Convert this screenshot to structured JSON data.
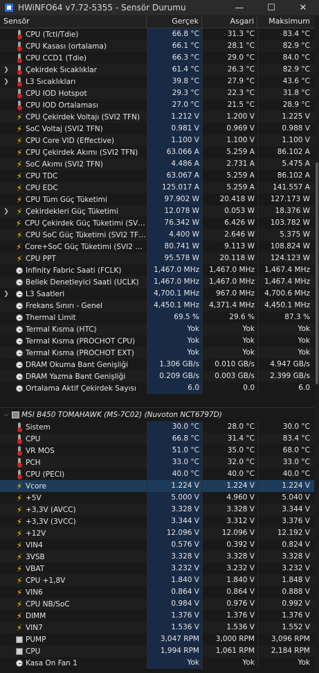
{
  "window": {
    "title": "HWiNFO64 v7.72-5355 - Sensör Durumu",
    "minimize": "—",
    "maximize": "☐",
    "close": "✕"
  },
  "columns": {
    "sensor": "Sensör",
    "current": "Gerçek",
    "min": "Asgari",
    "max": "Maksimum"
  },
  "colors": {
    "background": "#191919",
    "current_column": "#192a45",
    "selected_row": "#1d3c5a",
    "temp_icon": "#d32020",
    "voltage_icon": "#ffcc00"
  },
  "group_cpu": {
    "rows": [
      {
        "icon": "thermometer",
        "exp": false,
        "label": "CPU (Tctl/Tdie)",
        "cur": "66.8 °C",
        "min": "31.3 °C",
        "max": "83.4 °C"
      },
      {
        "icon": "thermometer",
        "exp": false,
        "label": "CPU Kasası (ortalama)",
        "cur": "66.1 °C",
        "min": "28.1 °C",
        "max": "82.9 °C"
      },
      {
        "icon": "thermometer",
        "exp": false,
        "label": "CPU CCD1 (Tdie)",
        "cur": "66.3 °C",
        "min": "29.0 °C",
        "max": "84.0 °C"
      },
      {
        "icon": "thermometer",
        "exp": true,
        "label": "Çekirdek Sıcaklıklar",
        "cur": "61.4 °C",
        "min": "26.3 °C",
        "max": "82.9 °C"
      },
      {
        "icon": "thermometer",
        "exp": true,
        "label": "L3 Sıcaklıkları",
        "cur": "39.8 °C",
        "min": "27.9 °C",
        "max": "43.6 °C"
      },
      {
        "icon": "thermometer",
        "exp": false,
        "label": "CPU IOD Hotspot",
        "cur": "29.3 °C",
        "min": "22.3 °C",
        "max": "31.8 °C"
      },
      {
        "icon": "thermometer",
        "exp": false,
        "label": "CPU IOD Ortalaması",
        "cur": "27.0 °C",
        "min": "21.5 °C",
        "max": "28.9 °C"
      },
      {
        "icon": "bolt",
        "exp": false,
        "label": "CPU Çekirdek Voltajı (SVI2 TFN)",
        "cur": "1.212 V",
        "min": "1.200 V",
        "max": "1.225 V"
      },
      {
        "icon": "bolt",
        "exp": false,
        "label": "SoC Voltaj (SVI2 TFN)",
        "cur": "0.981 V",
        "min": "0.969 V",
        "max": "0.988 V"
      },
      {
        "icon": "bolt",
        "exp": false,
        "label": "CPU Core VID (Effective)",
        "cur": "1.100 V",
        "min": "1.100 V",
        "max": "1.100 V"
      },
      {
        "icon": "bolt",
        "exp": false,
        "label": "CPU Çekirdek Akımı (SVI2 TFN)",
        "cur": "63.066 A",
        "min": "5.259 A",
        "max": "86.102 A"
      },
      {
        "icon": "bolt",
        "exp": false,
        "label": "SoC Akımı (SVI2 TFN)",
        "cur": "4.486 A",
        "min": "2.731 A",
        "max": "5.475 A"
      },
      {
        "icon": "bolt",
        "exp": false,
        "label": "CPU TDC",
        "cur": "63.067 A",
        "min": "5.259 A",
        "max": "86.102 A"
      },
      {
        "icon": "bolt",
        "exp": false,
        "label": "CPU EDC",
        "cur": "125.017 A",
        "min": "5.259 A",
        "max": "141.557 A"
      },
      {
        "icon": "bolt",
        "exp": false,
        "label": "CPU Tüm Güç Tüketimi",
        "cur": "97.902 W",
        "min": "20.418 W",
        "max": "127.173 W"
      },
      {
        "icon": "bolt",
        "exp": true,
        "label": "Çekirdekleri Güç Tüketimi",
        "cur": "12.078 W",
        "min": "0.053 W",
        "max": "18.376 W"
      },
      {
        "icon": "bolt",
        "exp": false,
        "label": "CPU Çekirdek Güç Tüketimi (SVI2 ...",
        "cur": "76.342 W",
        "min": "6.426 W",
        "max": "103.782 W"
      },
      {
        "icon": "bolt",
        "exp": false,
        "label": "CPU SoC Güç Tüketimi (SVI2 TFN)",
        "cur": "4.400 W",
        "min": "2.646 W",
        "max": "5.375 W"
      },
      {
        "icon": "bolt",
        "exp": false,
        "label": "Core+SoC Güç Tüketimi (SVI2 TFN)",
        "cur": "80.741 W",
        "min": "9.113 W",
        "max": "108.824 W"
      },
      {
        "icon": "bolt",
        "exp": false,
        "label": "CPU PPT",
        "cur": "95.578 W",
        "min": "20.118 W",
        "max": "124.123 W"
      },
      {
        "icon": "clock",
        "exp": false,
        "label": "Infinity Fabric Saati (FCLK)",
        "cur": "1,467.0 MHz",
        "min": "1,467.0 MHz",
        "max": "1,467.4 MHz"
      },
      {
        "icon": "clock",
        "exp": false,
        "label": "Bellek Denetleyici Saati (UCLK)",
        "cur": "1,467.0 MHz",
        "min": "1,467.0 MHz",
        "max": "1,467.4 MHz"
      },
      {
        "icon": "clock",
        "exp": true,
        "label": "L3 Saatleri",
        "cur": "4,700.1 MHz",
        "min": "967.0 MHz",
        "max": "4,700.6 MHz"
      },
      {
        "icon": "clock",
        "exp": false,
        "label": "Frekans Sınırı - Genel",
        "cur": "4,450.1 MHz",
        "min": "4,371.4 MHz",
        "max": "4,450.1 MHz"
      },
      {
        "icon": "clock",
        "exp": false,
        "label": "Thermal Limit",
        "cur": "69.5 %",
        "min": "29.6 %",
        "max": "87.3 %"
      },
      {
        "icon": "clock",
        "exp": false,
        "label": "Termal Kısma (HTC)",
        "cur": "Yok",
        "min": "Yok",
        "max": "Yok"
      },
      {
        "icon": "clock",
        "exp": false,
        "label": "Termal Kısma (PROCHOT CPU)",
        "cur": "Yok",
        "min": "Yok",
        "max": "Yok"
      },
      {
        "icon": "clock",
        "exp": false,
        "label": "Termal Kısma (PROCHOT EXT)",
        "cur": "Yok",
        "min": "Yok",
        "max": "Yok"
      },
      {
        "icon": "clock",
        "exp": false,
        "label": "DRAM Okuma Bant Genişliği",
        "cur": "1.306 GB/s",
        "min": "0.010 GB/s",
        "max": "4.947 GB/s"
      },
      {
        "icon": "clock",
        "exp": false,
        "label": "DRAM Yazma Bant Genişliği",
        "cur": "0.209 GB/s",
        "min": "0.003 GB/s",
        "max": "2.399 GB/s"
      },
      {
        "icon": "clock",
        "exp": false,
        "label": "Ortalama Aktif Çekirdek Sayısı",
        "cur": "6.0",
        "min": "0.0",
        "max": "6.0"
      }
    ]
  },
  "group_mb": {
    "title": "MSI B450 TOMAHAWK (MS-7C02) (Nuvoton NCT6797D)",
    "rows": [
      {
        "icon": "thermometer",
        "label": "Sistem",
        "cur": "30.0 °C",
        "min": "28.0 °C",
        "max": "30.0 °C"
      },
      {
        "icon": "thermometer",
        "label": "CPU",
        "cur": "66.8 °C",
        "min": "31.4 °C",
        "max": "83.4 °C"
      },
      {
        "icon": "thermometer",
        "label": "VR MOS",
        "cur": "51.0 °C",
        "min": "35.0 °C",
        "max": "68.0 °C"
      },
      {
        "icon": "thermometer",
        "label": "PCH",
        "cur": "33.0 °C",
        "min": "32.0 °C",
        "max": "33.0 °C"
      },
      {
        "icon": "thermometer",
        "label": "CPU (PECI)",
        "cur": "40.0 °C",
        "min": "40.0 °C",
        "max": "40.0 °C"
      },
      {
        "icon": "bolt",
        "label": "Vcore",
        "cur": "1.224 V",
        "min": "1.224 V",
        "max": "1.224 V",
        "selected": true
      },
      {
        "icon": "bolt",
        "label": "+5V",
        "cur": "5.000 V",
        "min": "4.960 V",
        "max": "5.040 V"
      },
      {
        "icon": "bolt",
        "label": "+3,3V (AVCC)",
        "cur": "3.328 V",
        "min": "3.328 V",
        "max": "3.344 V"
      },
      {
        "icon": "bolt",
        "label": "+3,3V (3VCC)",
        "cur": "3.344 V",
        "min": "3.312 V",
        "max": "3.376 V"
      },
      {
        "icon": "bolt",
        "label": "+12V",
        "cur": "12.096 V",
        "min": "12.096 V",
        "max": "12.192 V"
      },
      {
        "icon": "bolt",
        "label": "VIN4",
        "cur": "0.576 V",
        "min": "0.392 V",
        "max": "0.824 V"
      },
      {
        "icon": "bolt",
        "label": "3VSB",
        "cur": "3.328 V",
        "min": "3.328 V",
        "max": "3.328 V"
      },
      {
        "icon": "bolt",
        "label": "VBAT",
        "cur": "3.232 V",
        "min": "3.232 V",
        "max": "3.232 V"
      },
      {
        "icon": "bolt",
        "label": "CPU +1,8V",
        "cur": "1.840 V",
        "min": "1.840 V",
        "max": "1.848 V"
      },
      {
        "icon": "bolt",
        "label": "VIN6",
        "cur": "0.864 V",
        "min": "0.864 V",
        "max": "0.888 V"
      },
      {
        "icon": "bolt",
        "label": "CPU NB/SoC",
        "cur": "0.984 V",
        "min": "0.976 V",
        "max": "0.992 V"
      },
      {
        "icon": "bolt",
        "label": "DIMM",
        "cur": "1.376 V",
        "min": "1.376 V",
        "max": "1.376 V"
      },
      {
        "icon": "bolt",
        "label": "VIN7",
        "cur": "1.536 V",
        "min": "1.536 V",
        "max": "1.552 V"
      },
      {
        "icon": "fan",
        "label": "PUMP",
        "cur": "3,047 RPM",
        "min": "3,000 RPM",
        "max": "3,096 RPM"
      },
      {
        "icon": "fan",
        "label": "CPU",
        "cur": "1,994 RPM",
        "min": "1,061 RPM",
        "max": "2,184 RPM"
      },
      {
        "icon": "clock",
        "label": "Kasa Ön Fan 1",
        "cur": "Yok",
        "min": "Yok",
        "max": "Yok"
      }
    ]
  }
}
